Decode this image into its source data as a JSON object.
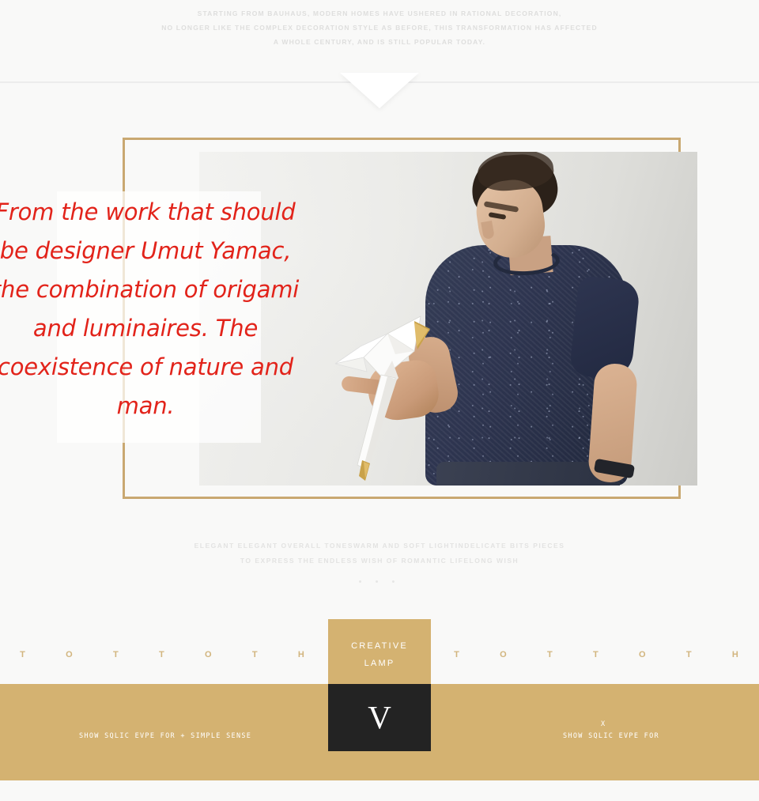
{
  "intro": {
    "lines": [
      "STARTING FROM BAUHAUS, MODERN HOMES HAVE USHERED IN RATIONAL DECORATION,",
      "NO LONGER LIKE THE COMPLEX DECORATION STYLE AS BEFORE, THIS TRANSFORMATION HAS AFFECTED",
      "A WHOLE CENTURY, AND IS STILL POPULAR TODAY."
    ]
  },
  "quote": {
    "text": "From the work that should be designer Umut Yamac, the combination of origami and luminaires. The coexistence of nature and man.",
    "color": "#e2231a"
  },
  "photo": {
    "alt": "Man in navy speckled t-shirt holding a white origami bird lamp"
  },
  "subcaption": {
    "lines": [
      "ELEGANT ELEGANT OVERALL TONESWARM AND SOFT LIGHTINDELICATE BITS PIECES",
      "TO EXPRESS THE ENDLESS WISH OF ROMANTIC LIFELONG WISH"
    ],
    "dots": "• • •"
  },
  "letter_strip": {
    "left": [
      "T",
      "O",
      "T",
      "T",
      "O",
      "T",
      "H"
    ],
    "right": [
      "T",
      "O",
      "T",
      "T",
      "O",
      "T",
      "H"
    ],
    "color": "#d2b57e"
  },
  "card": {
    "line1": "CREATIVE",
    "line2": "LAMP",
    "mark": "V",
    "gold": "#d4b271",
    "black": "#232323"
  },
  "bottom_bar": {
    "left_text": "SHOW  SQLIC EVPE  FOR  +  SIMPLE  SENSE",
    "right_text": "SHOW  SQLIC EVPE  FOR",
    "right_mark": "X",
    "background": "#d4b271"
  },
  "frame": {
    "border_color": "#c9a871"
  }
}
